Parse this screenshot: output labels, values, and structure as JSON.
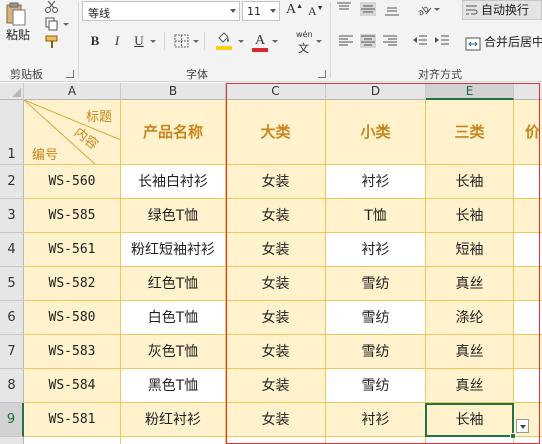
{
  "ribbon": {
    "clipboard": {
      "paste_label": "粘贴",
      "group_label": "剪贴板"
    },
    "font": {
      "font_name": "等线",
      "font_size": "11",
      "grow_label": "A",
      "shrink_label": "A",
      "bold_label": "B",
      "italic_label": "I",
      "underline_label": "U",
      "font_color_label": "A",
      "phonetic_label": "wén",
      "group_label": "字体",
      "fill_color": "#f5d20a",
      "font_color": "#d8282a"
    },
    "alignment": {
      "wrap_text_label": "自动换行",
      "merge_center_label": "合并后居中",
      "group_label": "对齐方式"
    }
  },
  "sheet": {
    "columns": [
      "A",
      "B",
      "C",
      "D",
      "E"
    ],
    "active_column": "E",
    "active_row": "9",
    "rows": [
      "1",
      "2",
      "3",
      "4",
      "5",
      "6",
      "7",
      "8",
      "9"
    ],
    "header_row": {
      "diag_title": "标题",
      "diag_content": "内容",
      "diag_number": "编号",
      "product_name": "产品名称",
      "category": "大类",
      "subcategory": "小类",
      "third_category": "三类",
      "clipped_header": "价"
    },
    "data": [
      {
        "code": "WS-560",
        "name": "长袖白衬衫",
        "category": "女装",
        "subcategory": "衬衫",
        "third": "长袖"
      },
      {
        "code": "WS-585",
        "name": "绿色T恤",
        "category": "女装",
        "subcategory": "T恤",
        "third": "长袖"
      },
      {
        "code": "WS-561",
        "name": "粉红短袖衬衫",
        "category": "女装",
        "subcategory": "衬衫",
        "third": "短袖"
      },
      {
        "code": "WS-582",
        "name": "红色T恤",
        "category": "女装",
        "subcategory": "雪纺",
        "third": "真丝"
      },
      {
        "code": "WS-580",
        "name": "白色T恤",
        "category": "女装",
        "subcategory": "雪纺",
        "third": "涤纶"
      },
      {
        "code": "WS-583",
        "name": "灰色T恤",
        "category": "女装",
        "subcategory": "雪纺",
        "third": "真丝"
      },
      {
        "code": "WS-584",
        "name": "黑色T恤",
        "category": "女装",
        "subcategory": "雪纺",
        "third": "真丝"
      },
      {
        "code": "WS-581",
        "name": "粉红衬衫",
        "category": "女装",
        "subcategory": "衬衫",
        "third": "长袖"
      }
    ],
    "colors": {
      "cell_yellow": "#fff2cc",
      "border_gold": "#f1c65a",
      "header_text": "#c8861e",
      "highlight_box": "#e0303a",
      "selection": "#217346"
    }
  }
}
